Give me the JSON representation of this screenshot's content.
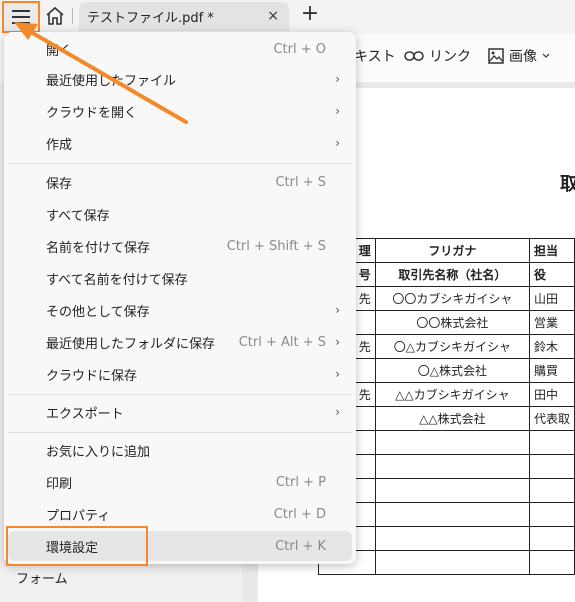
{
  "tabbar": {
    "tab_title": "テストファイル.pdf *",
    "close_glyph": "×",
    "new_tab_glyph": "+"
  },
  "toolbar": {
    "text_partial": "キスト",
    "link_label": "リンク",
    "image_label": "画像"
  },
  "menu": {
    "items": [
      {
        "label": "開く",
        "shortcut": "Ctrl + O",
        "submenu": false
      },
      {
        "label": "最近使用したファイル",
        "shortcut": "",
        "submenu": true
      },
      {
        "label": "クラウドを開く",
        "shortcut": "",
        "submenu": true
      },
      {
        "label": "作成",
        "shortcut": "",
        "submenu": true
      },
      {
        "label": "保存",
        "shortcut": "Ctrl + S",
        "submenu": false
      },
      {
        "label": "すべて保存",
        "shortcut": "",
        "submenu": false
      },
      {
        "label": "名前を付けて保存",
        "shortcut": "Ctrl + Shift + S",
        "submenu": false
      },
      {
        "label": "すべて名前を付けて保存",
        "shortcut": "",
        "submenu": false
      },
      {
        "label": "その他として保存",
        "shortcut": "",
        "submenu": true
      },
      {
        "label": "最近使用したフォルダに保存",
        "shortcut": "Ctrl + Alt + S",
        "submenu": true
      },
      {
        "label": "クラウドに保存",
        "shortcut": "",
        "submenu": true
      },
      {
        "label": "エクスポート",
        "shortcut": "",
        "submenu": true
      },
      {
        "label": "お気に入りに追加",
        "shortcut": "",
        "submenu": false
      },
      {
        "label": "印刷",
        "shortcut": "Ctrl + P",
        "submenu": false
      },
      {
        "label": "プロパティ",
        "shortcut": "Ctrl + D",
        "submenu": false
      },
      {
        "label": "環境設定",
        "shortcut": "Ctrl + K",
        "submenu": false
      }
    ],
    "chevron_glyph": "›"
  },
  "sidebar": {
    "form_label": "フォーム"
  },
  "document": {
    "title_partial": "取",
    "header": {
      "c0": "理",
      "c0b": "号",
      "c1": "フリガナ",
      "c1b": "取引先名称（社名）",
      "c2": "担当",
      "c2b": "役"
    },
    "rows": [
      {
        "c0": "先",
        "c1": "〇〇カブシキガイシャ",
        "c2": "山田"
      },
      {
        "c0": "",
        "c1": "〇〇株式会社",
        "c2": "営業"
      },
      {
        "c0": "先",
        "c1": "〇△カブシキガイシャ",
        "c2": "鈴木"
      },
      {
        "c0": "",
        "c1": "〇△株式会社",
        "c2": "購買"
      },
      {
        "c0": "先",
        "c1": "△△カブシキガイシャ",
        "c2": "田中"
      },
      {
        "c0": "",
        "c1": "△△株式会社",
        "c2": "代表取"
      }
    ]
  }
}
